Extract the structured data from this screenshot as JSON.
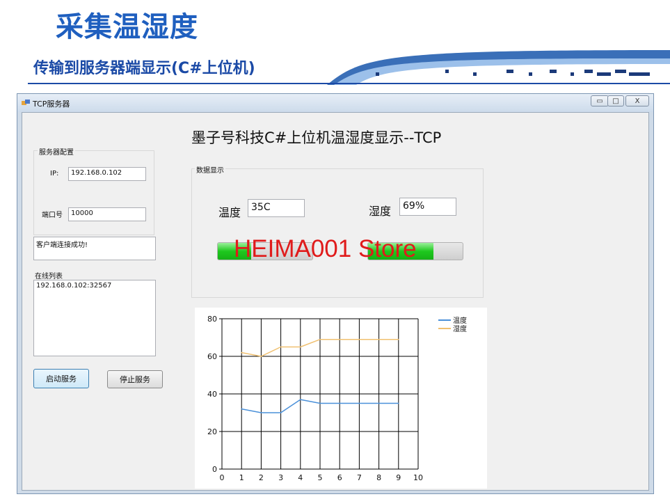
{
  "slide": {
    "title": "采集温湿度",
    "subtitle": "传输到服务器端显示(C#上位机)"
  },
  "window": {
    "title": "TCP服务器",
    "minimize": "▭",
    "maximize": "□",
    "close": "X"
  },
  "server_config": {
    "group_label": "服务器配置",
    "ip_label": "IP:",
    "ip_value": "192.168.0.102",
    "port_label": "端口号",
    "port_value": "10000"
  },
  "status_text": "客户端连接成功!",
  "online": {
    "label": "在线列表",
    "items": [
      "192.168.0.102:32567"
    ]
  },
  "buttons": {
    "start": "启动服务",
    "stop": "停止服务"
  },
  "main_heading": "墨子号科技C#上位机温湿度显示--TCP",
  "data_display": {
    "group_label": "数据显示",
    "temp_label": "温度",
    "temp_value": "35C",
    "humidity_label": "湿度",
    "humidity_value": "69%",
    "temp_progress": 0.35,
    "humidity_progress": 0.69
  },
  "watermark": "HEIMA001 Store",
  "colors": {
    "temperature_series": "#4a90d9",
    "humidity_series": "#f0c070",
    "progress_fill": "#1ec81e"
  },
  "chart_data": {
    "type": "line",
    "xlim": [
      0,
      10
    ],
    "ylim": [
      0,
      80
    ],
    "x_ticks": [
      0,
      1,
      2,
      3,
      4,
      5,
      6,
      7,
      8,
      9,
      10
    ],
    "y_ticks": [
      0,
      20,
      40,
      60,
      80
    ],
    "grid": true,
    "legend_position": "top-right",
    "series": [
      {
        "name": "温度",
        "color": "#4a90d9",
        "x": [
          1,
          2,
          3,
          4,
          5,
          6,
          7,
          8,
          9
        ],
        "y": [
          32,
          30,
          30,
          37,
          35,
          35,
          35,
          35,
          35
        ]
      },
      {
        "name": "湿度",
        "color": "#f0c070",
        "x": [
          1,
          2,
          3,
          4,
          5,
          6,
          7,
          8,
          9
        ],
        "y": [
          62,
          60,
          65,
          65,
          69,
          69,
          69,
          69,
          69
        ]
      }
    ]
  }
}
